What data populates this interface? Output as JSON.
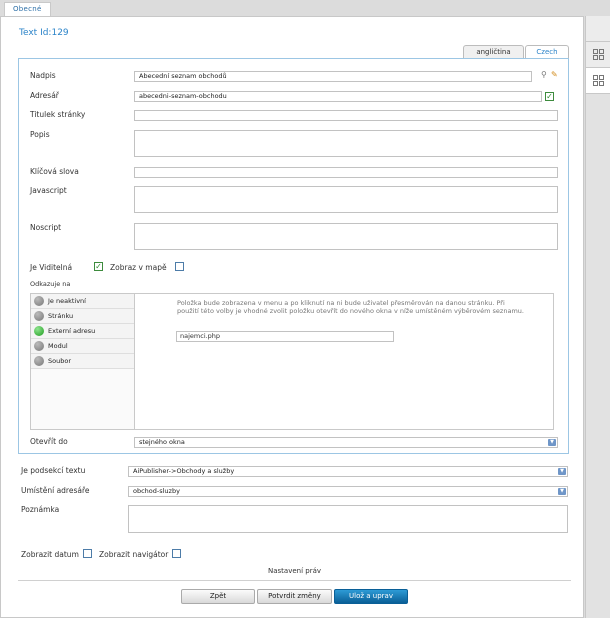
{
  "top_tab": "Obecné",
  "page_title": "Text Id:129",
  "lang_tabs": [
    "angličtina",
    "Czech"
  ],
  "labels": {
    "nadpis": "Nadpis",
    "adresar": "Adresář",
    "titulek": "Titulek stránky",
    "popis": "Popis",
    "klicova": "Klíčová slova",
    "javascript": "Javascript",
    "noscript": "Noscript",
    "je_viditelna": "Je Viditelná",
    "zobraz_v_mape": "Zobraz v mapě",
    "odkazuje_na": "Odkazuje na",
    "otevrit_do": "Otevřít do",
    "je_podsekci": "Je podsekcí textu",
    "umisteni": "Umístění adresáře",
    "poznamka": "Poznámka",
    "zobrazit_datum": "Zobrazit datum",
    "zobrazit_navigator": "Zobrazit navigátor",
    "nastaveni_prav": "Nastavení práv"
  },
  "values": {
    "nadpis": "Abecední seznam obchodů",
    "adresar": "abecedni-seznam-obchodu",
    "odkaz_url": "najemci.php",
    "otevrit_do": "stejného okna",
    "je_podsekci": "AiPublisher->Obchody a služby",
    "umisteni": "obchod-sluzby"
  },
  "ref_items": [
    "Je neaktivní",
    "Stránku",
    "Externí adresu",
    "Modul",
    "Soubor"
  ],
  "ref_help": "Položka bude zobrazena v menu a po kliknutí na ni bude uživatel přesměrován na danou stránku. Při použití této volby je vhodné zvolit položku otevřít do nového okna v níže umístěném výběrovém seznamu.",
  "buttons": {
    "zpet": "Zpět",
    "potvrdit": "Potvrdit změny",
    "uloz": "Ulož a uprav"
  },
  "colors": {
    "accent": "#2c84c9",
    "primary_button": "#0a5f97",
    "active_indicator": "#1f9b1f"
  }
}
